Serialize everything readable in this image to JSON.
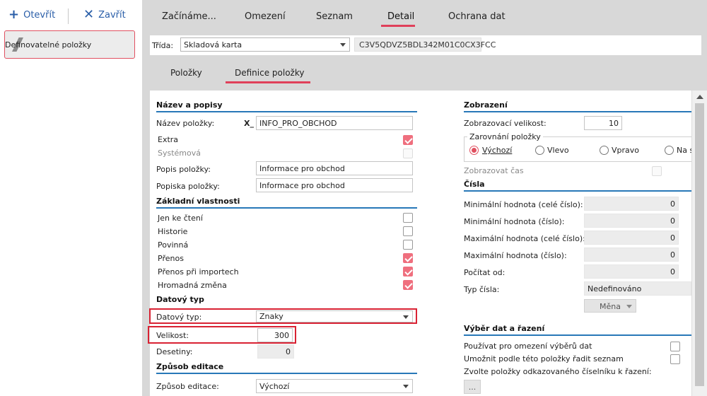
{
  "toolbar": {
    "open_label": "Otevřít",
    "close_label": "Zavřít"
  },
  "nav": {
    "item_label": "Definovatelné položky"
  },
  "tabs": [
    {
      "label": "Začínáme..."
    },
    {
      "label": "Omezení"
    },
    {
      "label": "Seznam"
    },
    {
      "label": "Detail"
    },
    {
      "label": "Ochrana dat"
    }
  ],
  "class_row": {
    "label": "Třída:",
    "value": "Skladová karta",
    "code": "C3V5QDVZ5BDL342M01C0CX3FCC"
  },
  "sub_tabs": [
    {
      "label": "Položky"
    },
    {
      "label": "Definice položky"
    }
  ],
  "left": {
    "sec_name": "Název a popisy",
    "name_label": "Název položky:",
    "name_prefix": "X_",
    "name_value": "INFO_PRO_OBCHOD",
    "extra_label": "Extra",
    "system_label": "Systémová",
    "desc_label": "Popis položky:",
    "desc_value": "Informace pro obchod",
    "caption_label": "Popiska položky:",
    "caption_value": "Informace pro obchod",
    "sec_basic": "Základní vlastnosti",
    "readonly_label": "Jen ke čtení",
    "history_label": "Historie",
    "required_label": "Povinná",
    "transfer_label": "Přenos",
    "import_label": "Přenos při importech",
    "bulk_label": "Hromadná změna",
    "sec_datatype": "Datový typ",
    "datatype_label": "Datový typ:",
    "datatype_value": "Znaky",
    "size_label": "Velikost:",
    "size_value": "300",
    "decimals_label": "Desetiny:",
    "decimals_value": "0",
    "sec_edit": "Způsob editace",
    "edit_label": "Způsob editace:",
    "edit_value": "Výchozí"
  },
  "right": {
    "sec_display": "Zobrazení",
    "disp_size_label": "Zobrazovací velikost:",
    "disp_size_value": "10",
    "align_group": "Zarovnání položky",
    "align_default": "Výchozí",
    "align_left": "Vlevo",
    "align_right": "Vpravo",
    "align_center": "Na s",
    "show_time_label": "Zobrazovat čas",
    "sec_numbers": "Čísla",
    "min_int_label": "Minimální hodnota (celé číslo):",
    "min_int_value": "0",
    "min_num_label": "Minimální hodnota (číslo):",
    "min_num_value": "0",
    "max_int_label": "Maximální hodnota (celé číslo):",
    "max_int_value": "0",
    "max_num_label": "Maximální hodnota (číslo):",
    "max_num_value": "0",
    "count_from_label": "Počítat od:",
    "count_from_value": "0",
    "num_type_label": "Typ čísla:",
    "num_type_value": "Nedefinováno",
    "currency_label": "Měna",
    "sec_select": "Výběr dat a řazení",
    "use_filter_label": "Používat pro omezení výběrů dat",
    "sort_label": "Umožnit podle této položky řadit seznam",
    "choose_label": "Zvolte položky odkazovaného číselníku k řazení:",
    "ellipsis_label": "..."
  },
  "colors": {
    "accent": "#e0405a",
    "section_line": "#2878b8",
    "highlight": "#d92233",
    "link": "#2a5ea8"
  }
}
